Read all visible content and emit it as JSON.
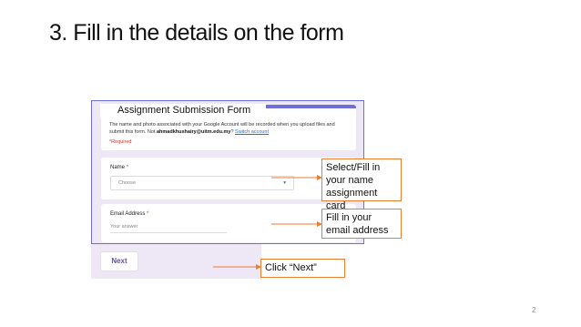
{
  "slide": {
    "title": "3. Fill in the details on the form",
    "page_number": "2"
  },
  "form": {
    "title": "Assignment Submission Form",
    "description_prefix": "The name and photo associated with your Google Account will be recorded when you upload files and submit this form. Not ",
    "account_email": "ahmadkhushairy@uitm.edu.my",
    "description_suffix": "? ",
    "switch_account_link": "Switch account",
    "required_note": "*Required",
    "name_question": {
      "label": "Name",
      "required_marker": "*",
      "selected_value": "Choose",
      "caret": "▾"
    },
    "email_question": {
      "label": "Email Address",
      "required_marker": "*",
      "placeholder": "Your answer"
    },
    "next_button": "Next",
    "accent_color": "#6b6fd6",
    "background_color": "#ede7f6"
  },
  "callouts": {
    "select_name": "Select/Fill in your name assignment card",
    "fill_email": "Fill in your email address",
    "click_next": "Click “Next”",
    "border_color": "#ed7d31"
  }
}
